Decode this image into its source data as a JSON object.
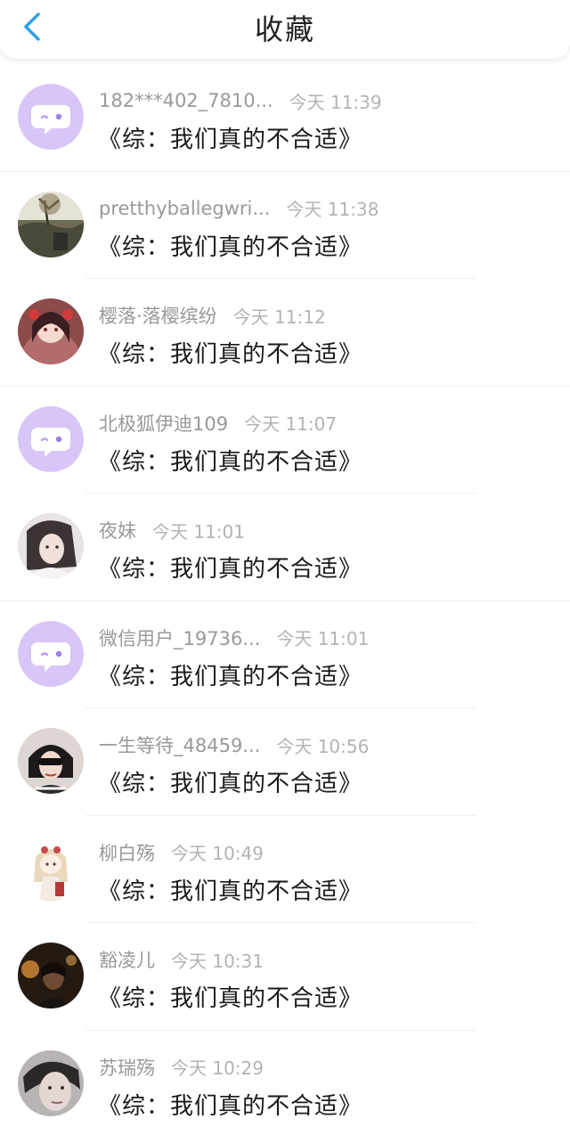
{
  "header": {
    "title": "收藏",
    "back_icon": "chevron-left-icon",
    "accent_color": "#2d9fe8"
  },
  "items": [
    {
      "username": "182***402_7810...",
      "time": "今天 11:39",
      "book": "《综：我们真的不合适》",
      "avatar": "default-chat-avatar"
    },
    {
      "username": "pretthyballegwri...",
      "time": "今天 11:38",
      "book": "《综：我们真的不合适》",
      "avatar": "photo-avatar"
    },
    {
      "username": "樱落·落樱缤纷",
      "time": "今天 11:12",
      "book": "《综：我们真的不合适》",
      "avatar": "photo-avatar"
    },
    {
      "username": "北极狐伊迪109",
      "time": "今天 11:07",
      "book": "《综：我们真的不合适》",
      "avatar": "default-chat-avatar"
    },
    {
      "username": "夜妹",
      "time": "今天 11:01",
      "book": "《综：我们真的不合适》",
      "avatar": "photo-avatar"
    },
    {
      "username": "微信用户_19736...",
      "time": "今天 11:01",
      "book": "《综：我们真的不合适》",
      "avatar": "default-chat-avatar"
    },
    {
      "username": "一生等待_48459...",
      "time": "今天 10:56",
      "book": "《综：我们真的不合适》",
      "avatar": "photo-avatar"
    },
    {
      "username": "柳白殇",
      "time": "今天 10:49",
      "book": "《综：我们真的不合适》",
      "avatar": "photo-avatar"
    },
    {
      "username": "豁凌儿",
      "time": "今天 10:31",
      "book": "《综：我们真的不合适》",
      "avatar": "photo-avatar"
    },
    {
      "username": "苏瑞殇",
      "time": "今天 10:29",
      "book": "《综：我们真的不合适》",
      "avatar": "photo-avatar"
    }
  ]
}
